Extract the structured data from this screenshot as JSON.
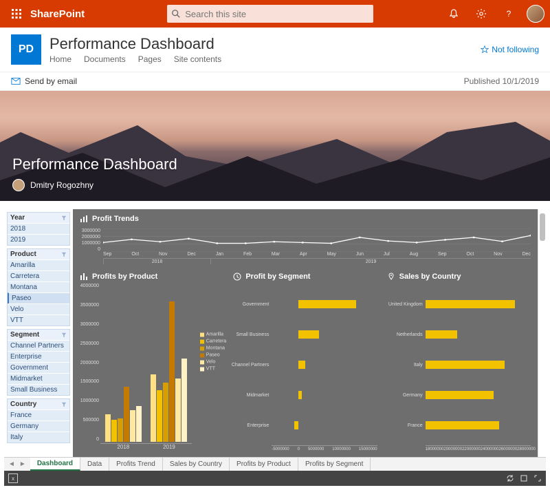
{
  "topbar": {
    "brand": "SharePoint",
    "search_placeholder": "Search this site"
  },
  "site": {
    "logo_initials": "PD",
    "title": "Performance Dashboard",
    "nav": {
      "home": "Home",
      "documents": "Documents",
      "pages": "Pages",
      "contents": "Site contents"
    },
    "follow_label": "Not following"
  },
  "cmdbar": {
    "send_label": "Send by email",
    "published_label": "Published 10/1/2019"
  },
  "hero": {
    "title": "Performance Dashboard",
    "author": "Dmitry Rogozhny"
  },
  "filters": {
    "year": {
      "label": "Year",
      "items": [
        "2018",
        "2019"
      ]
    },
    "product": {
      "label": "Product",
      "items": [
        "Amarilla",
        "Carretera",
        "Montana",
        "Paseo",
        "Velo",
        "VTT"
      ],
      "selected": "Paseo"
    },
    "segment": {
      "label": "Segment",
      "items": [
        "Channel Partners",
        "Enterprise",
        "Government",
        "Midmarket",
        "Small Business"
      ]
    },
    "country": {
      "label": "Country",
      "items": [
        "France",
        "Germany",
        "Italy"
      ]
    }
  },
  "panel_titles": {
    "trends": "Profit Trends",
    "by_product": "Profits by Product",
    "by_segment": "Profit by Segment",
    "by_country": "Sales by Country"
  },
  "sheet_tabs": [
    "Dashboard",
    "Data",
    "Profits Trend",
    "Sales by Country",
    "Profits by Product",
    "Profits by Segment"
  ],
  "product_colors": {
    "Amarilla": "#ffe082",
    "Carretera": "#f2c200",
    "Montana": "#d89e00",
    "Paseo": "#c47a00",
    "Velo": "#ffe8a0",
    "VTT": "#fff2c7"
  },
  "chart_data": [
    {
      "id": "profit_trends",
      "type": "line",
      "title": "Profit Trends",
      "xlabel": "",
      "ylabel": "",
      "ylim": [
        0,
        3000000
      ],
      "yticks": [
        0,
        1000000,
        2000000,
        3000000
      ],
      "x": [
        "Sep",
        "Oct",
        "Nov",
        "Dec",
        "Jan",
        "Feb",
        "Mar",
        "Apr",
        "May",
        "Jun",
        "Jul",
        "Aug",
        "Sep",
        "Oct",
        "Nov",
        "Dec"
      ],
      "year_groups": [
        {
          "label": "2018",
          "span": 4
        },
        {
          "label": "2019",
          "span": 12
        }
      ],
      "series": [
        {
          "name": "Profit",
          "values": [
            1200000,
            1600000,
            1300000,
            1700000,
            1100000,
            1100000,
            1300000,
            1200000,
            1100000,
            1850000,
            1400000,
            1200000,
            1550000,
            1850000,
            1350000,
            2100000
          ]
        }
      ]
    },
    {
      "id": "profits_by_product",
      "type": "bar",
      "title": "Profits by Product",
      "categories": [
        "2018",
        "2019"
      ],
      "ylim": [
        0,
        4000000
      ],
      "yticks": [
        0,
        500000,
        1000000,
        1500000,
        2000000,
        2500000,
        3000000,
        3500000,
        4000000
      ],
      "series": [
        {
          "name": "Amarilla",
          "values": [
            700000,
            1700000
          ]
        },
        {
          "name": "Carretera",
          "values": [
            550000,
            1300000
          ]
        },
        {
          "name": "Montana",
          "values": [
            600000,
            1500000
          ]
        },
        {
          "name": "Paseo",
          "values": [
            1400000,
            3550000
          ]
        },
        {
          "name": "Velo",
          "values": [
            800000,
            1600000
          ]
        },
        {
          "name": "VTT",
          "values": [
            900000,
            2100000
          ]
        }
      ]
    },
    {
      "id": "profit_by_segment",
      "type": "bar_h",
      "title": "Profit by Segment",
      "xlim": [
        -5000000,
        15000000
      ],
      "xticks": [
        -5000000,
        0,
        5000000,
        10000000,
        15000000
      ],
      "categories": [
        "Government",
        "Small Business",
        "Channel Partners",
        "Midmarket",
        "Enterprise"
      ],
      "values": [
        11000000,
        4000000,
        1300000,
        700000,
        -700000
      ]
    },
    {
      "id": "sales_by_country",
      "type": "bar_h",
      "title": "Sales by Country",
      "xlim": [
        18000000,
        28000000
      ],
      "xticks": [
        18000000,
        20000000,
        22000000,
        24000000,
        26000000,
        28000000
      ],
      "categories": [
        "United Kingdom",
        "Netherlands",
        "Italy",
        "Germany",
        "France"
      ],
      "values": [
        26500000,
        21000000,
        25500000,
        24500000,
        25000000
      ]
    }
  ]
}
